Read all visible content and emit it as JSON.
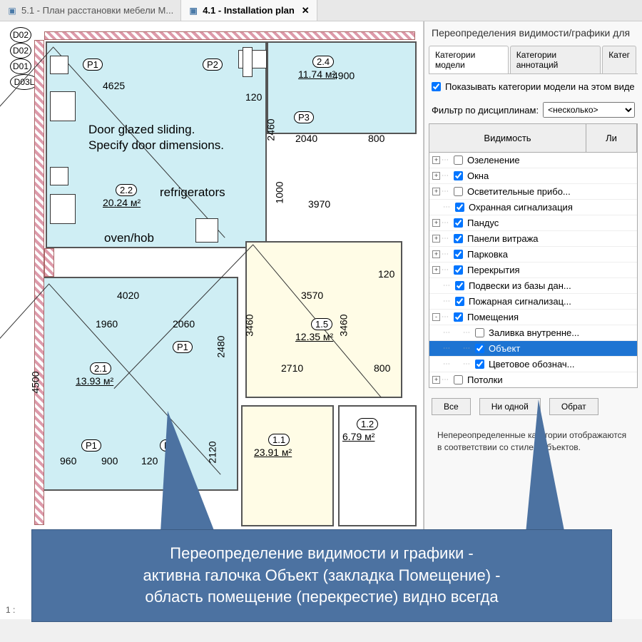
{
  "tabs": [
    {
      "label": "5.1 - План расстановки мебели М...",
      "active": false
    },
    {
      "label": "4.1 - Installation plan",
      "active": true
    }
  ],
  "status_scale": "1 :",
  "panel": {
    "title": "Переопределения видимости/графики для",
    "subtabs": [
      "Категории модели",
      "Категории аннотаций",
      "Катег"
    ],
    "show_categories_label": "Показывать категории модели на этом виде",
    "filter_label": "Фильтр по дисциплинам:",
    "filter_value": "<несколько>",
    "header_col1": "Видимость",
    "header_col2": "Ли",
    "buttons": {
      "all": "Все",
      "none": "Ни одной",
      "invert": "Обрат"
    },
    "description": "Непереопределенные категории отображаются в соответствии со стилем объектов."
  },
  "tree": [
    {
      "level": 0,
      "exp": "+",
      "checked": false,
      "label": "Озеленение"
    },
    {
      "level": 0,
      "exp": "+",
      "checked": true,
      "label": "Окна"
    },
    {
      "level": 0,
      "exp": "+",
      "checked": false,
      "label": "Осветительные прибо..."
    },
    {
      "level": 0,
      "exp": "",
      "checked": true,
      "label": "Охранная сигнализация"
    },
    {
      "level": 0,
      "exp": "+",
      "checked": true,
      "label": "Пандус"
    },
    {
      "level": 0,
      "exp": "+",
      "checked": true,
      "label": "Панели витража"
    },
    {
      "level": 0,
      "exp": "+",
      "checked": true,
      "label": "Парковка"
    },
    {
      "level": 0,
      "exp": "+",
      "checked": true,
      "label": "Перекрытия"
    },
    {
      "level": 0,
      "exp": "",
      "checked": true,
      "label": "Подвески из базы дан..."
    },
    {
      "level": 0,
      "exp": "",
      "checked": true,
      "label": "Пожарная сигнализац..."
    },
    {
      "level": 0,
      "exp": "-",
      "checked": true,
      "label": "Помещения"
    },
    {
      "level": 1,
      "exp": "",
      "checked": false,
      "label": "Заливка внутренне..."
    },
    {
      "level": 1,
      "exp": "",
      "checked": true,
      "label": "Объект",
      "selected": true
    },
    {
      "level": 1,
      "exp": "",
      "checked": true,
      "label": "Цветовое обознач..."
    },
    {
      "level": 0,
      "exp": "+",
      "checked": false,
      "label": "Потолки"
    }
  ],
  "plan": {
    "notes": {
      "door": "Door glazed sliding.",
      "door2": "Specify door dimensions.",
      "refrigerators": "refrigerators",
      "ovenhob": "oven/hob"
    },
    "rooms": {
      "r22": {
        "num": "2.2",
        "area": "20.24 м²"
      },
      "r21": {
        "num": "2.1",
        "area": "13.93 м²"
      },
      "r24": {
        "num": "2.4",
        "area": "11.74 м²"
      },
      "r15": {
        "num": "1.5",
        "area": "12.35 м²"
      },
      "r11": {
        "num": "1.1",
        "area": "23.91 м²"
      },
      "r12": {
        "num": "1.2",
        "area": "6.79 м²"
      }
    },
    "tags": {
      "p1a": "P1",
      "p2": "P2",
      "p3": "P3",
      "p1b": "P1",
      "p1c": "P1",
      "p1d": "P1",
      "d01": "D01",
      "d02a": "D02",
      "d02b": "D02",
      "d03l": "D03L"
    },
    "dims": {
      "d4625": "4625",
      "d120a": "120",
      "d4900": "4900",
      "d2460": "2460",
      "d2040": "2040",
      "d800a": "800",
      "d1000": "1000",
      "d3970": "3970",
      "d4020": "4020",
      "d3570": "3570",
      "d120b": "120",
      "d1960": "1960",
      "d2060": "2060",
      "d2480": "2480",
      "d3460a": "3460",
      "d3460b": "3460",
      "d2710": "2710",
      "d800b": "800",
      "d4500": "4500",
      "d960": "960",
      "d900": "900",
      "d120c": "120",
      "d2120": "2120"
    }
  },
  "callout": {
    "line1": "Переопределение видимости и графики -",
    "line2": "активна галочка Объект (закладка Помещение) -",
    "line3": "область помещение (перекрестие) видно всегда"
  }
}
